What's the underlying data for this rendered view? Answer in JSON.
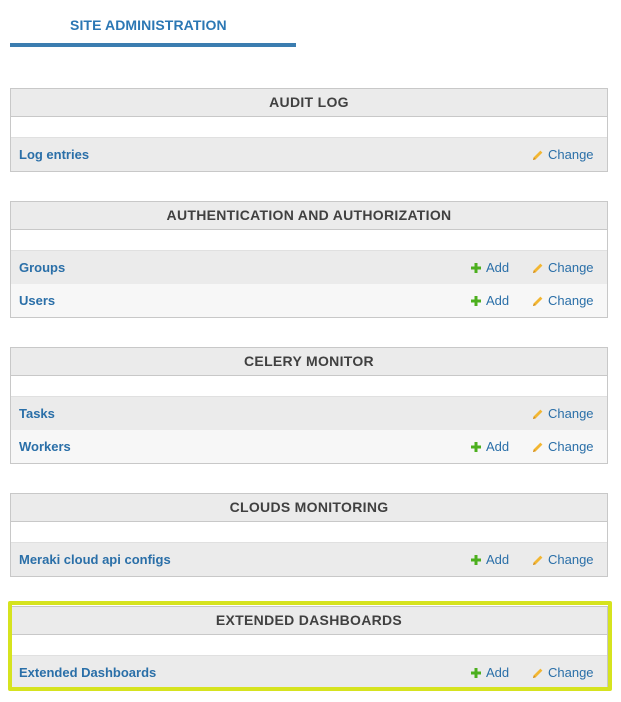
{
  "header": {
    "title": "SITE ADMINISTRATION"
  },
  "colors": {
    "link": "#2a6fa8",
    "add_icon": "#4caf1e",
    "change_icon": "#f2b632",
    "highlight": "#d6e31f"
  },
  "modules": [
    {
      "title": "AUDIT LOG",
      "rows": [
        {
          "label": "Log entries",
          "add": "",
          "change": "Change"
        }
      ]
    },
    {
      "title": "AUTHENTICATION AND AUTHORIZATION",
      "rows": [
        {
          "label": "Groups",
          "add": "Add",
          "change": "Change"
        },
        {
          "label": "Users",
          "add": "Add",
          "change": "Change"
        }
      ]
    },
    {
      "title": "CELERY MONITOR",
      "rows": [
        {
          "label": "Tasks",
          "add": "",
          "change": "Change"
        },
        {
          "label": "Workers",
          "add": "Add",
          "change": "Change"
        }
      ]
    },
    {
      "title": "CLOUDS MONITORING",
      "rows": [
        {
          "label": "Meraki cloud api configs",
          "add": "Add",
          "change": "Change"
        }
      ]
    },
    {
      "title": "EXTENDED DASHBOARDS",
      "highlighted": true,
      "rows": [
        {
          "label": "Extended Dashboards",
          "add": "Add",
          "change": "Change"
        }
      ]
    }
  ]
}
